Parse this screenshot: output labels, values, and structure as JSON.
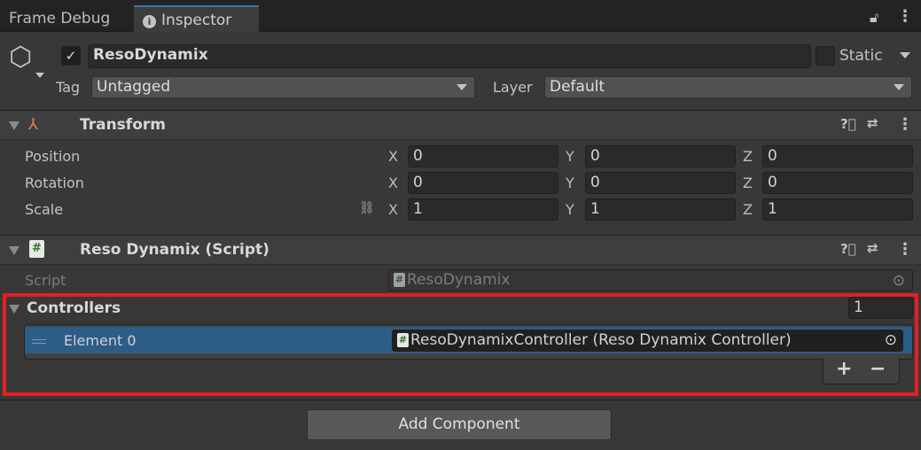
{
  "tabs": [
    {
      "label": "Frame Debug"
    },
    {
      "label": "Inspector"
    }
  ],
  "object": {
    "name": "ResoDynamix",
    "active": true,
    "static_label": "Static",
    "tag_label": "Tag",
    "tag_value": "Untagged",
    "layer_label": "Layer",
    "layer_value": "Default"
  },
  "transform": {
    "title": "Transform",
    "rows": [
      {
        "label": "Position",
        "x": "0",
        "y": "0",
        "z": "0"
      },
      {
        "label": "Rotation",
        "x": "0",
        "y": "0",
        "z": "0"
      },
      {
        "label": "Scale",
        "x": "1",
        "y": "1",
        "z": "1"
      }
    ],
    "axes": {
      "x": "X",
      "y": "Y",
      "z": "Z"
    }
  },
  "script_component": {
    "title": "Reso Dynamix (Script)",
    "script_label": "Script",
    "script_value": "ResoDynamix",
    "controllers_label": "Controllers",
    "controllers_count": "1",
    "elements": [
      {
        "label": "Element 0",
        "value": "ResoDynamixController (Reso Dynamix Controller)"
      }
    ],
    "add_label": "+",
    "remove_label": "−"
  },
  "add_component_label": "Add Component",
  "colors": {
    "highlight": "#e41e26",
    "selected": "#2c5d87"
  }
}
